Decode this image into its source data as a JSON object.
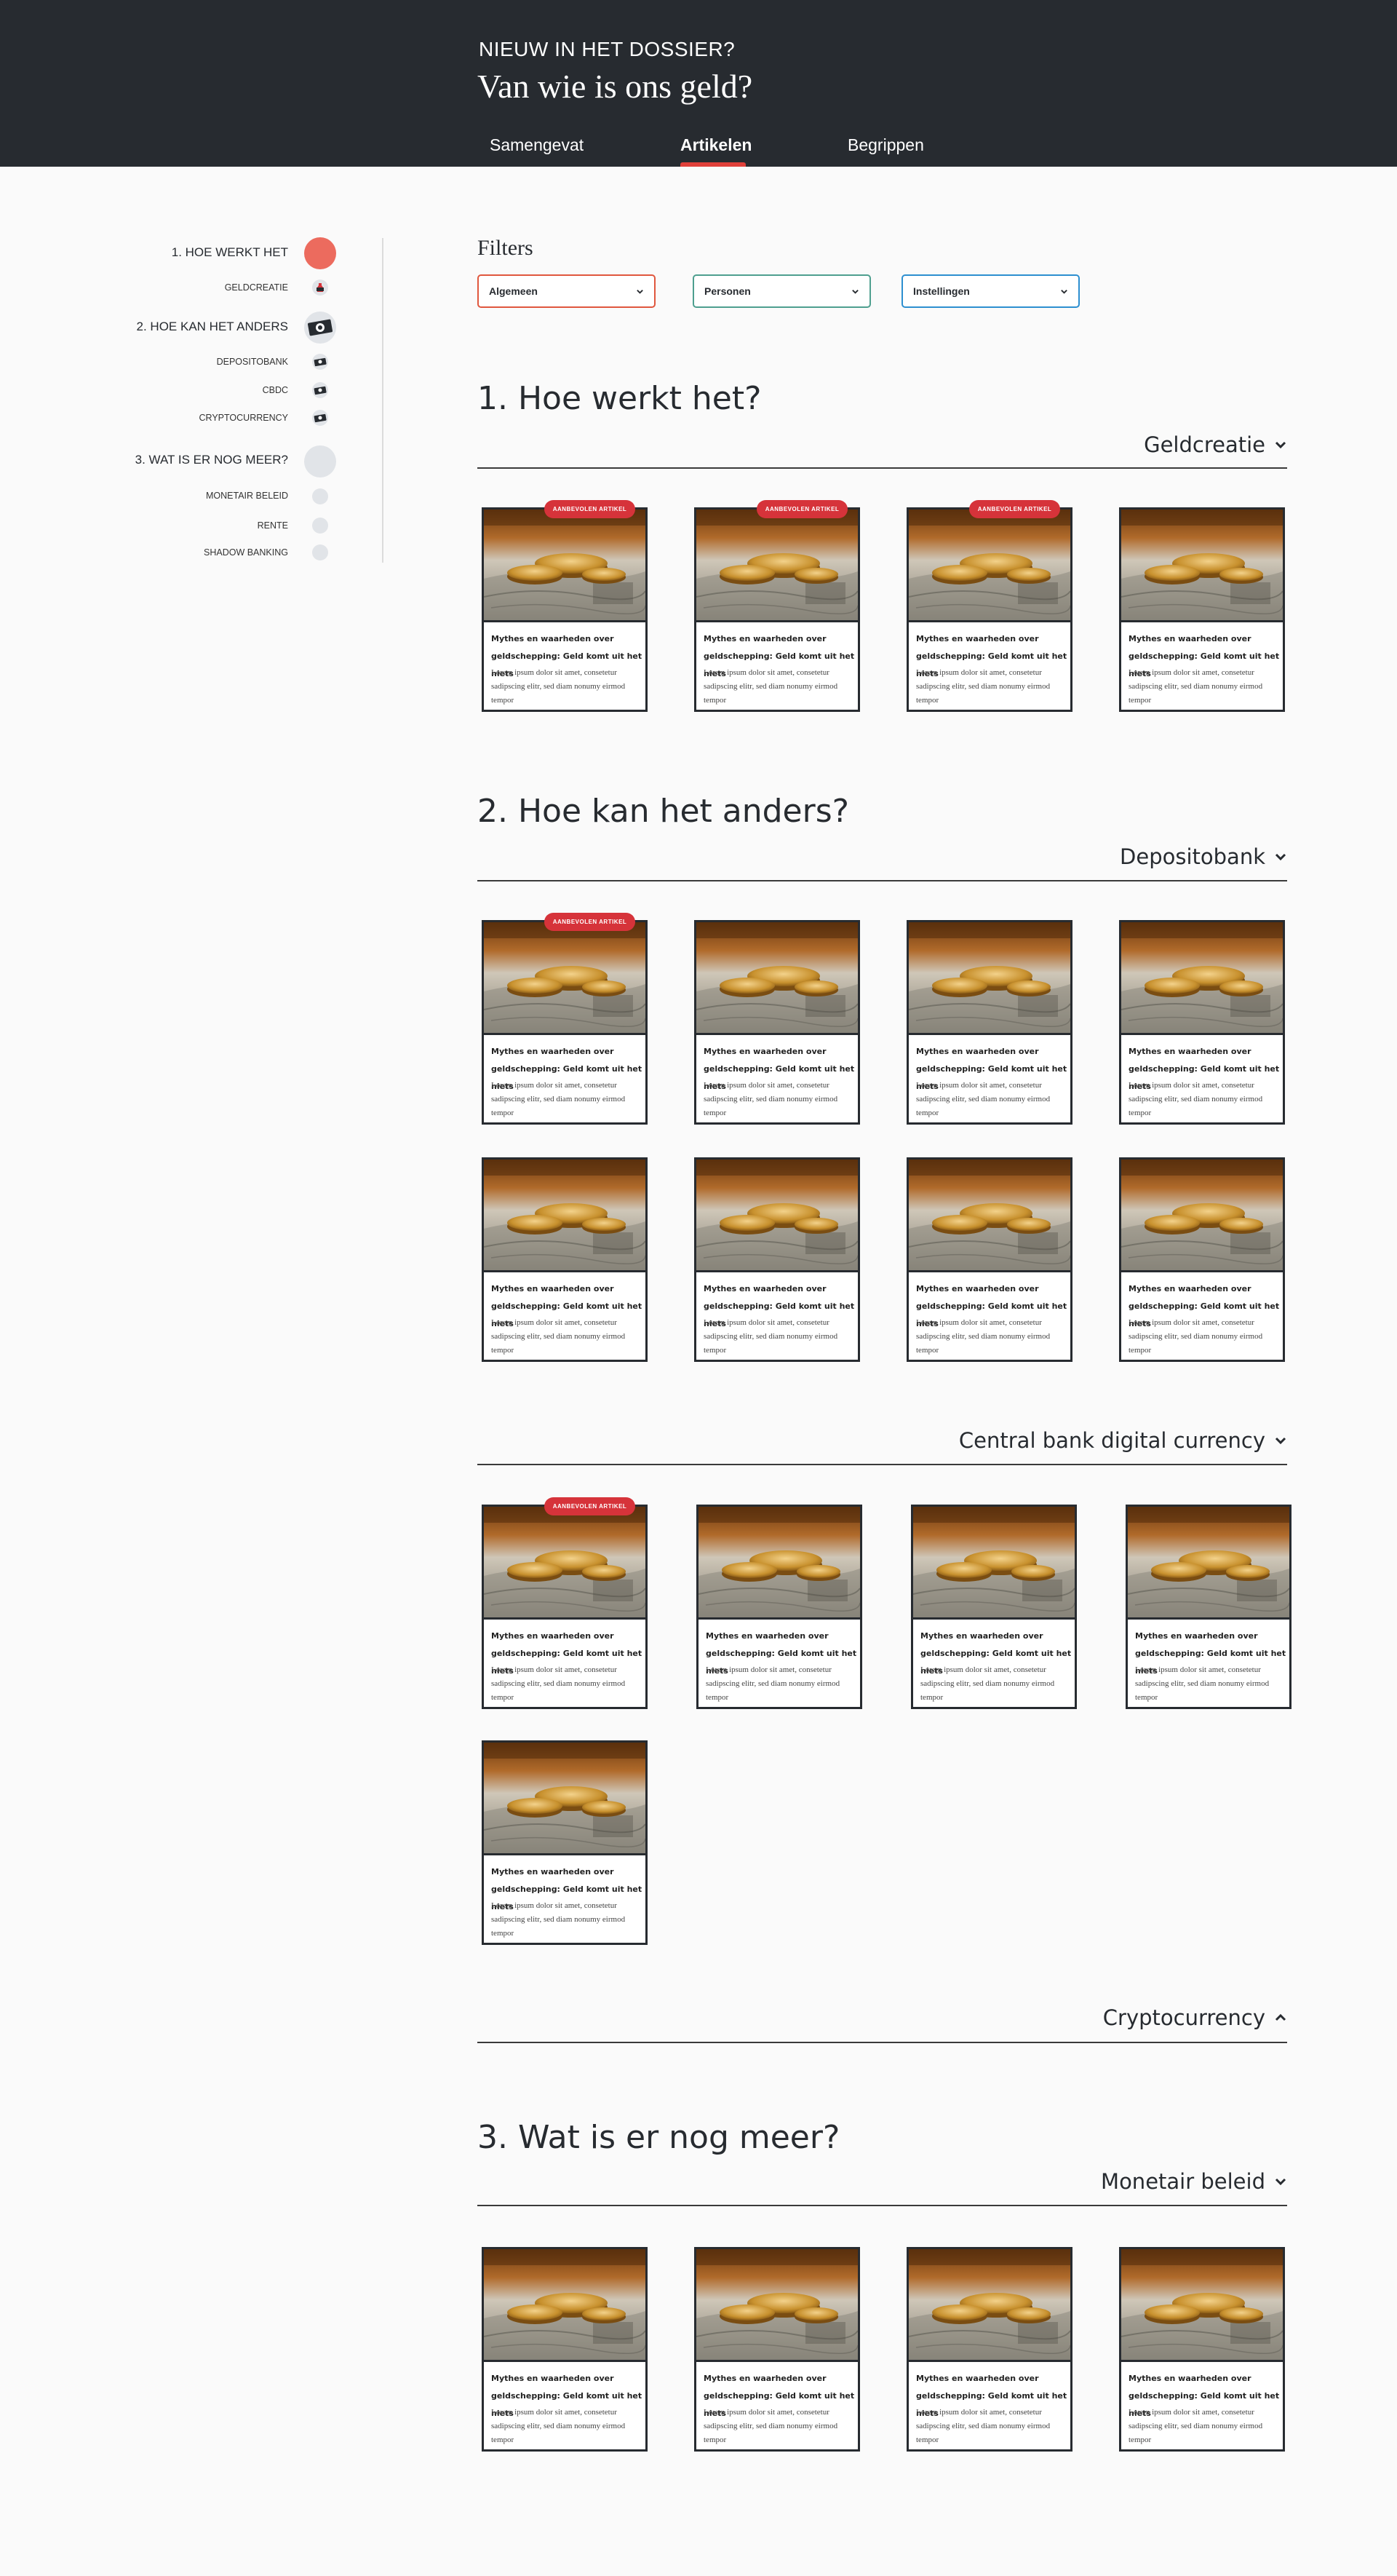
{
  "header": {
    "kicker": "NIEUW IN HET DOSSIER?",
    "title": "Van wie is ons geld?",
    "tabs": [
      {
        "label": "Samengevat",
        "active": false
      },
      {
        "label": "Artikelen",
        "active": true
      },
      {
        "label": "Begrippen",
        "active": false
      }
    ]
  },
  "sidebar": {
    "sections": [
      {
        "label": "1. HOE WERKT HET",
        "items": [
          "GELDCREATIE"
        ]
      },
      {
        "label": "2. HOE KAN HET ANDERS",
        "items": [
          "DEPOSITOBANK",
          "CBDC",
          "CRYPTOCURRENCY"
        ]
      },
      {
        "label": "3. WAT IS ER NOG MEER?",
        "items": [
          "MONETAIR BELEID",
          "RENTE",
          "SHADOW BANKING"
        ]
      }
    ]
  },
  "filters": {
    "title": "Filters",
    "items": [
      {
        "label": "Algemeen",
        "color": "#e0573e"
      },
      {
        "label": "Personen",
        "color": "#4e9f8f"
      },
      {
        "label": "Instellingen",
        "color": "#2d8fd0"
      }
    ]
  },
  "card": {
    "badge": "AANBEVOLEN ARTIKEL",
    "title": "Mythes en waarheden over geldschepping: Geld komt uit het niets",
    "body": "Lorem ipsum dolor sit amet, consetetur sadipscing elitr, sed diam nonumy eirmod tempor"
  },
  "sections": [
    {
      "title": "1. Hoe werkt het?",
      "subsections": [
        {
          "label": "Geldcreatie",
          "expanded": true
        }
      ]
    },
    {
      "title": "2. Hoe kan het anders?",
      "subsections": [
        {
          "label": "Depositobank",
          "expanded": true
        },
        {
          "label": "Central bank digital currency",
          "expanded": true
        },
        {
          "label": "Cryptocurrency",
          "expanded": false
        }
      ]
    },
    {
      "title": "3. Wat is er nog meer?",
      "subsections": [
        {
          "label": "Monetair beleid",
          "expanded": true
        }
      ]
    }
  ],
  "colors": {
    "header_bg": "#272b30",
    "accent": "#e0403a",
    "badge": "#d6333a",
    "active_dot": "#ec6b5e"
  }
}
